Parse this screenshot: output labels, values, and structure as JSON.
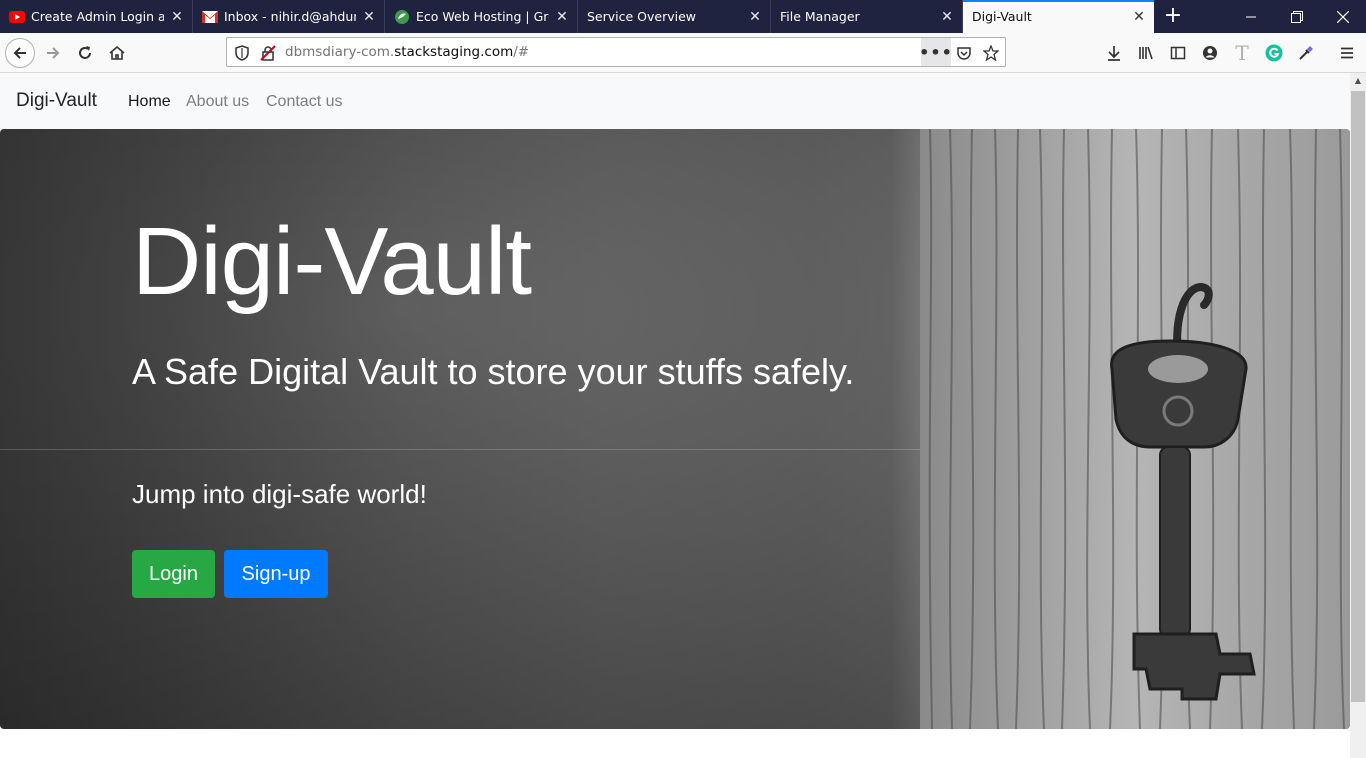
{
  "browser": {
    "tabs": [
      {
        "title": "Create Admin Login and",
        "icon": "youtube-icon"
      },
      {
        "title": "Inbox - nihir.d@ahduni.e",
        "icon": "gmail-icon"
      },
      {
        "title": "Eco Web Hosting | Green",
        "icon": "eco-hosting-icon"
      },
      {
        "title": "Service Overview",
        "icon": "none"
      },
      {
        "title": "File Manager",
        "icon": "none"
      },
      {
        "title": "Digi-Vault",
        "icon": "none",
        "active": true
      }
    ],
    "url_prefix": "dbmsdiary-com.",
    "url_domain": "stackstaging.com",
    "url_suffix": "/#",
    "accent_color": "#0a84ff"
  },
  "site": {
    "brand": "Digi-Vault",
    "nav": {
      "home": "Home",
      "about": "About us",
      "contact": "Contact us"
    },
    "hero": {
      "title": "Digi-Vault",
      "lead": "A Safe Digital Vault to store your stuffs safely.",
      "subtitle": "Jump into digi-safe world!",
      "login_label": "Login",
      "signup_label": "Sign-up",
      "login_color": "#28a745",
      "signup_color": "#007bff"
    }
  }
}
